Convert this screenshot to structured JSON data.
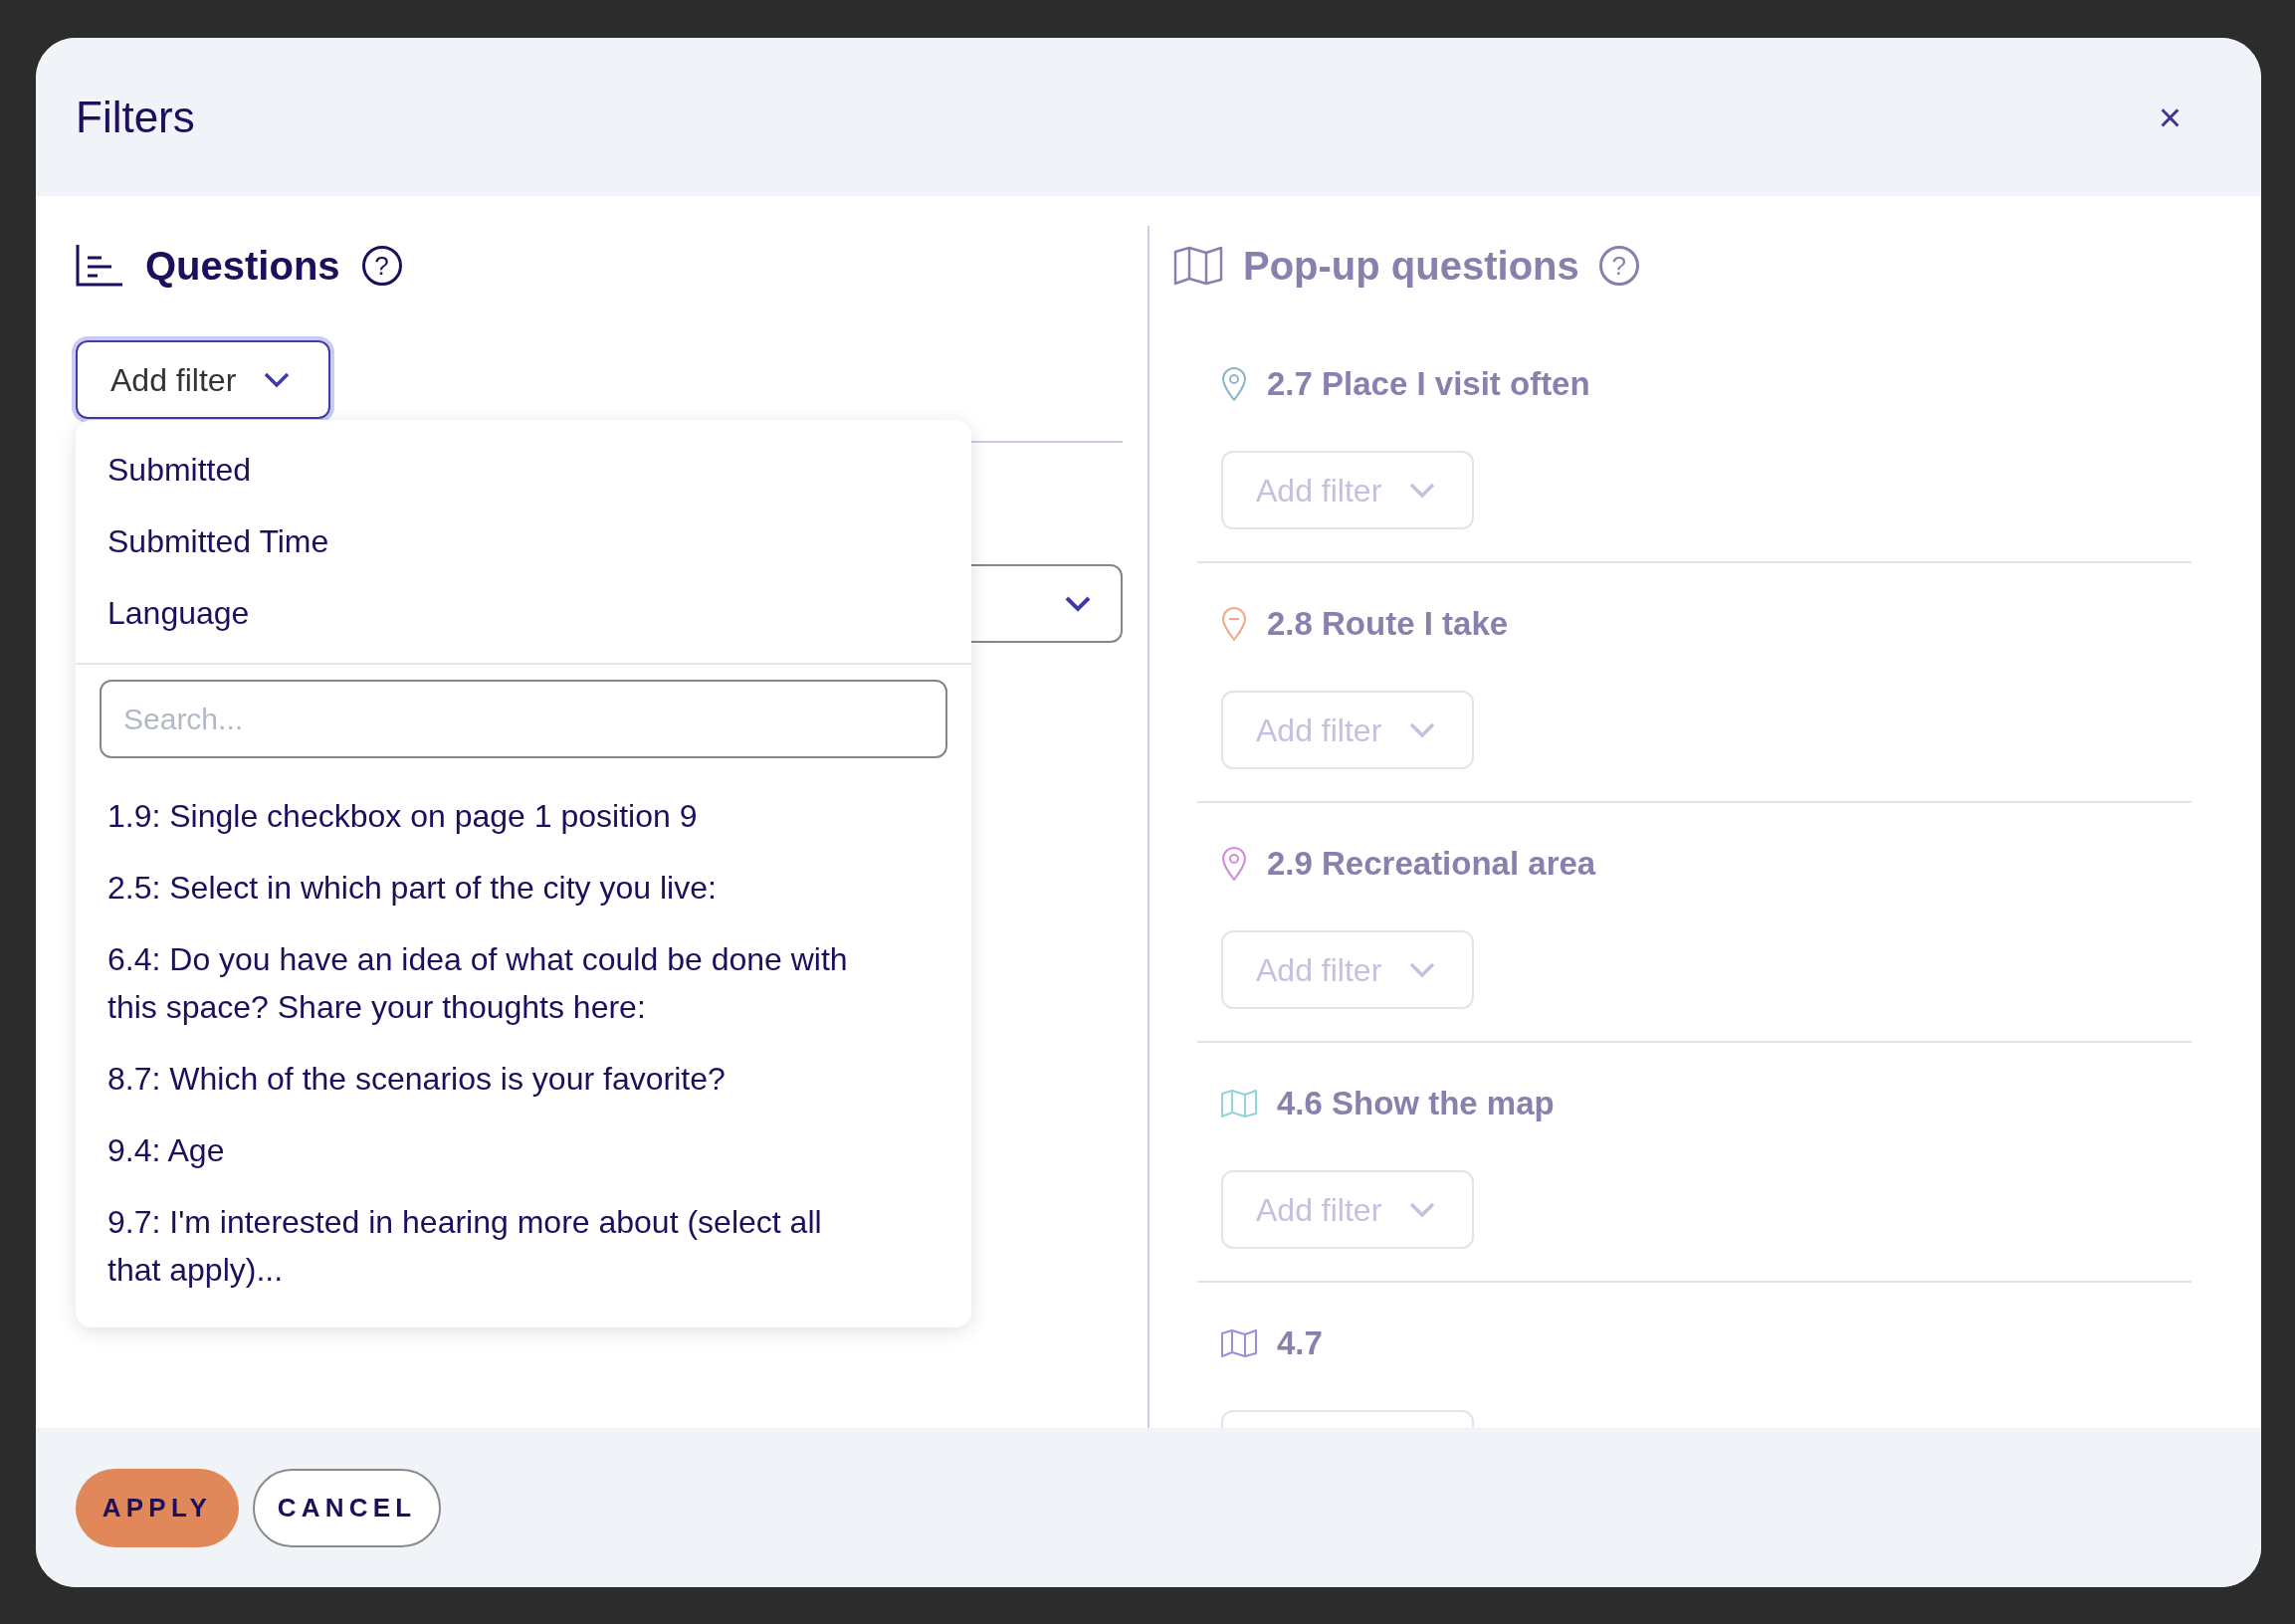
{
  "dialog": {
    "title": "Filters",
    "close": "×"
  },
  "questions": {
    "title": "Questions",
    "help": "?",
    "add_filter": "Add filter",
    "menu": {
      "fixed_options": [
        "Submitted",
        "Submitted Time",
        "Language"
      ],
      "search": {
        "placeholder": "Search..."
      },
      "options": [
        "1.9: Single checkbox on page 1 position 9",
        "2.5: Select in which part of the city you live:",
        "6.4: Do you have an idea of what could be done with this space? Share your thoughts here:",
        "8.7: Which of the scenarios is your favorite?",
        "9.4: Age",
        "9.7: I'm interested in hearing more about (select all that apply)..."
      ]
    }
  },
  "popup_questions": {
    "title": "Pop-up questions",
    "help": "?",
    "items": [
      {
        "kind": "pin",
        "color": "#8fb4c8",
        "title": "2.7 Place I visit often",
        "add_filter": "Add filter"
      },
      {
        "kind": "route",
        "color": "#f2a88a",
        "title": "2.8 Route I take",
        "add_filter": "Add filter"
      },
      {
        "kind": "pin",
        "color": "#d08ad8",
        "title": "2.9 Recreational area",
        "add_filter": "Add filter"
      },
      {
        "kind": "map",
        "color": "#94d2dc",
        "title": "4.6 Show the map",
        "add_filter": "Add filter"
      },
      {
        "kind": "map",
        "color": "#9a90d4",
        "title": "4.7"
      }
    ]
  },
  "footer": {
    "apply": "APPLY",
    "cancel": "CANCEL"
  }
}
